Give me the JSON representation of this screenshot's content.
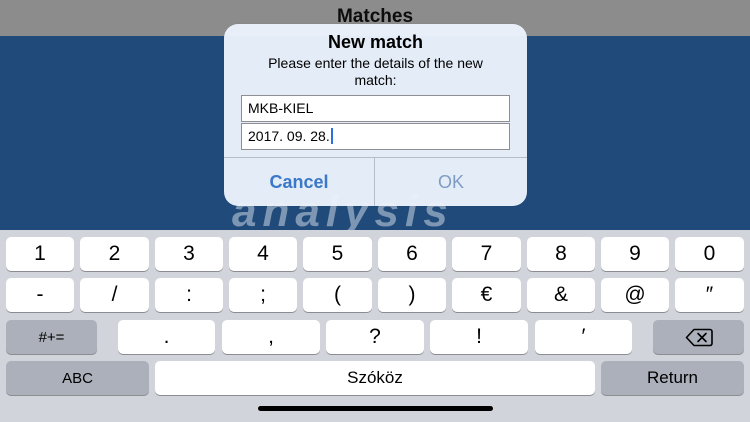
{
  "navbar": {
    "title": "Matches"
  },
  "background": {
    "logo_text": "analysis"
  },
  "dialog": {
    "title": "New match",
    "message": "Please enter the details of the new match:",
    "field_name_value": "MKB-KIEL",
    "field_date_value": "2017. 09. 28.",
    "cancel_label": "Cancel",
    "ok_label": "OK"
  },
  "keyboard": {
    "row1": [
      "1",
      "2",
      "3",
      "4",
      "5",
      "6",
      "7",
      "8",
      "9",
      "0"
    ],
    "row2": [
      "-",
      "/",
      ":",
      ";",
      "(",
      ")",
      "€",
      "&",
      "@",
      "″"
    ],
    "row3": {
      "symbols_label": "#+=",
      "keys": [
        ".",
        ",",
        "?",
        "!",
        "′"
      ],
      "delete_icon": "backspace-icon"
    },
    "row4": {
      "abc_label": "ABC",
      "space_label": "Szóköz",
      "return_label": "Return"
    }
  },
  "colors": {
    "accent": "#3a78c8",
    "app_background": "#1f4a7a",
    "keyboard_background": "#d1d4da"
  }
}
